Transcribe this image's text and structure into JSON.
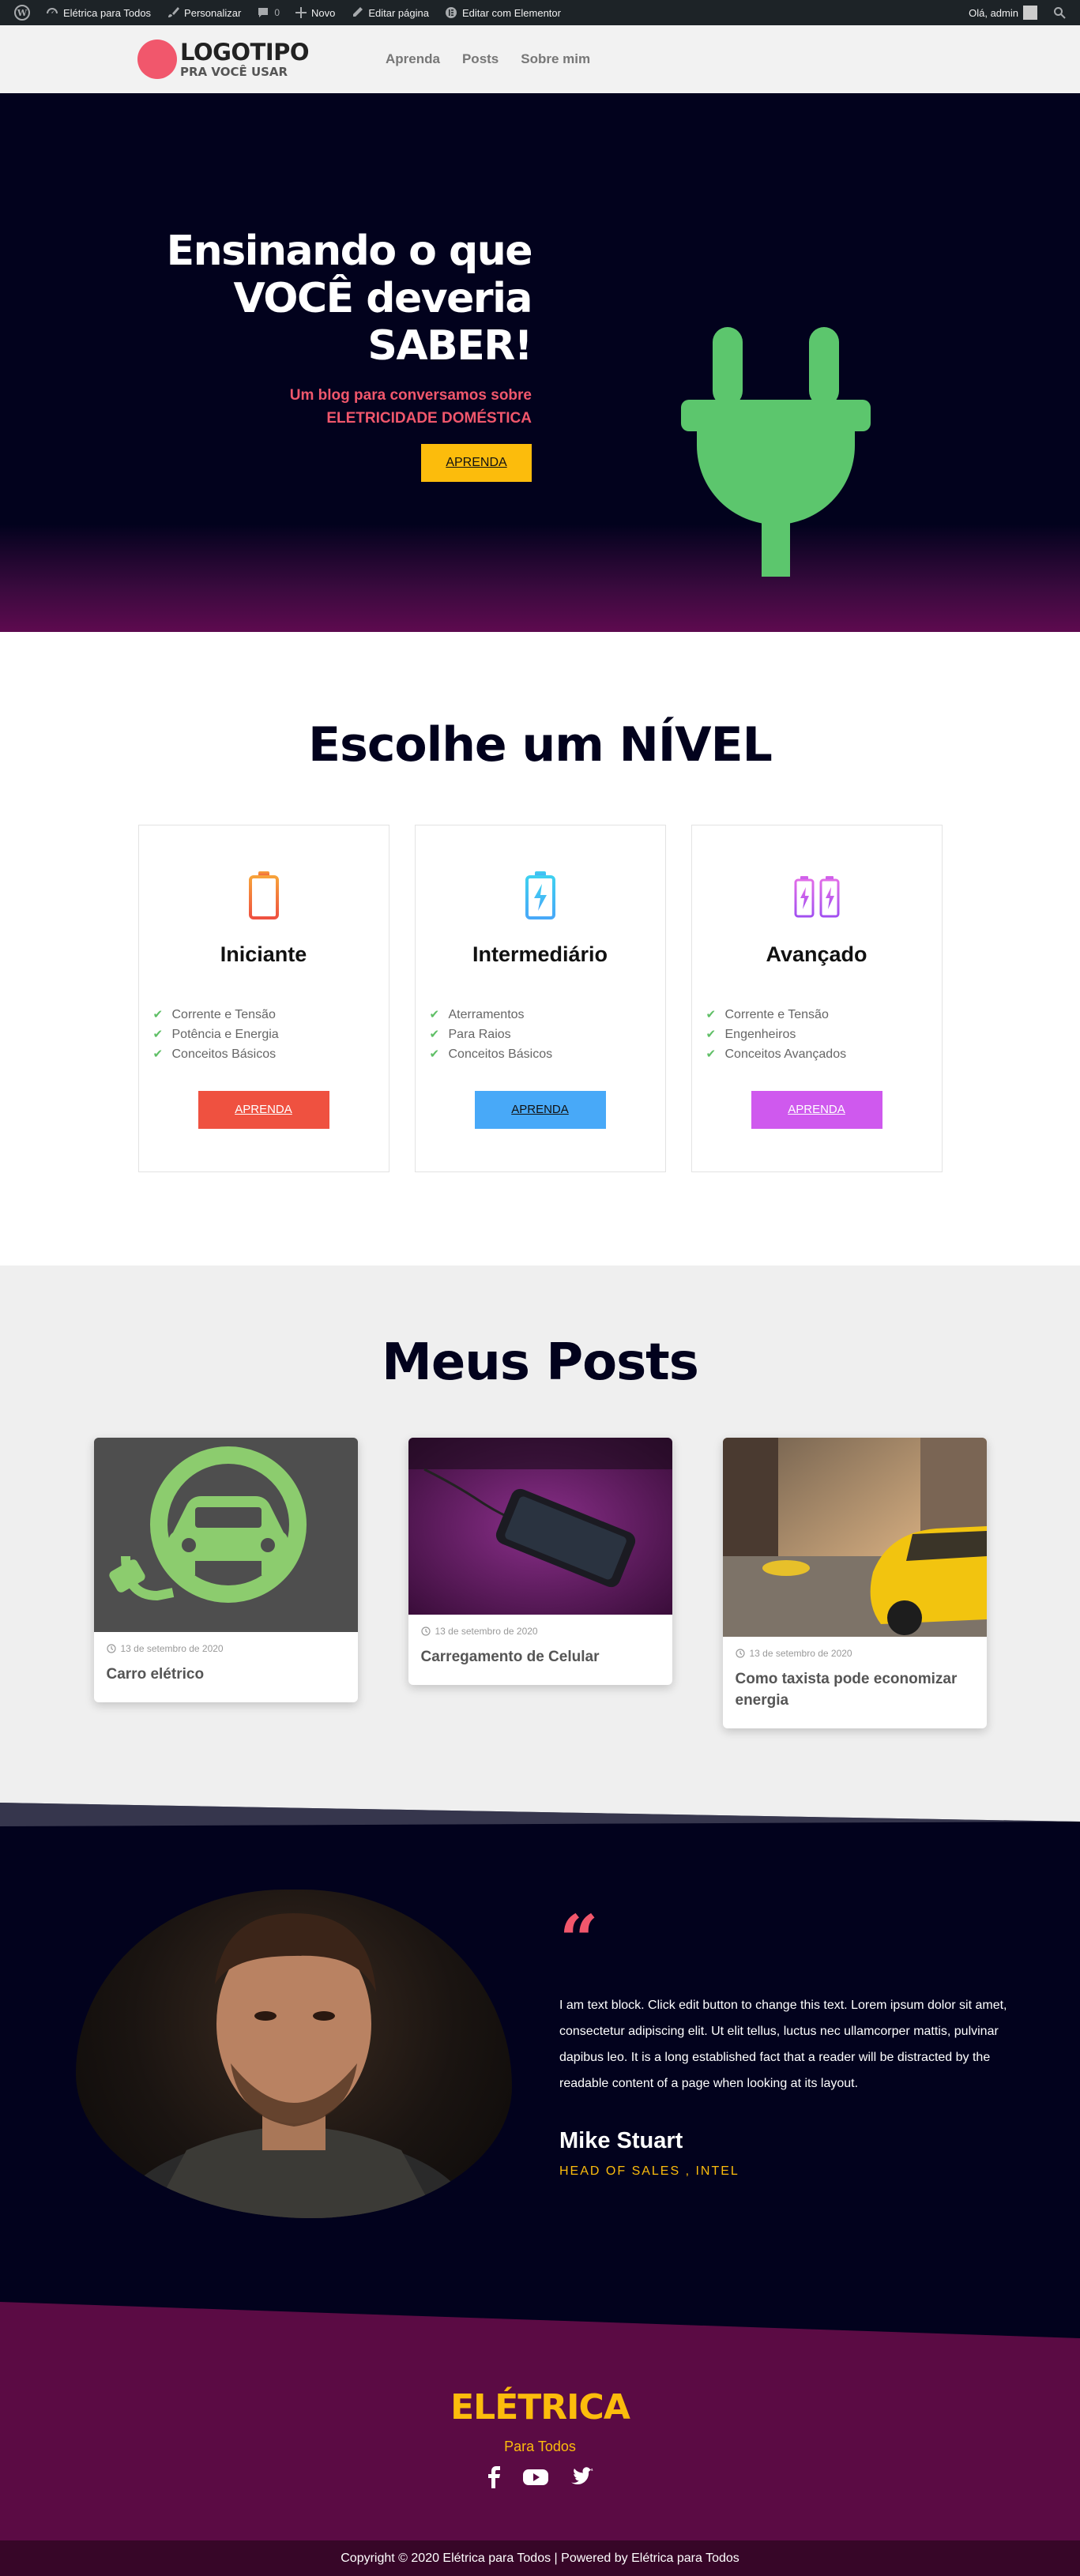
{
  "admin_bar": {
    "site_name": "Elétrica para Todos",
    "customize": "Personalizar",
    "comments_count": "0",
    "new": "Novo",
    "edit_page": "Editar página",
    "edit_elementor": "Editar com Elementor",
    "greeting": "Olá, admin"
  },
  "header": {
    "logo_title": "LOGOTIPO",
    "logo_subtitle": "PRA VOCÊ USAR",
    "nav": [
      "Aprenda",
      "Posts",
      "Sobre mim"
    ]
  },
  "hero": {
    "title_lines": [
      "Ensinando o que",
      "VOCÊ deveria",
      "SABER!"
    ],
    "subtitle_lines": [
      "Um blog para conversamos sobre",
      "ELETRICIDADE DOMÉSTICA"
    ],
    "button": "APRENDA",
    "icon": "plug-icon",
    "colors": {
      "background": "#02021d",
      "accent": "#f1576c",
      "plug": "#5cc66d",
      "button": "#fcbc0c"
    }
  },
  "levels": {
    "title": "Escolhe um NÍVEL",
    "cards": [
      {
        "title": "Iniciante",
        "icon": "battery-low-icon",
        "items": [
          "Corrente e Tensão",
          "Potência e Energia",
          "Conceitos Básicos"
        ],
        "button": "APRENDA",
        "color": "#ef5140"
      },
      {
        "title": "Intermediário",
        "icon": "battery-charging-icon",
        "items": [
          "Aterramentos",
          "Para Raios",
          "Conceitos Básicos"
        ],
        "button": "APRENDA",
        "color": "#48a9f8"
      },
      {
        "title": "Avançado",
        "icon": "batteries-icon",
        "items": [
          "Corrente e Tensão",
          "Engenheiros",
          "Conceitos Avançados"
        ],
        "button": "APRENDA",
        "color": "#cf59ee"
      }
    ]
  },
  "posts": {
    "title": "Meus Posts",
    "items": [
      {
        "date": "13 de setembro de 2020",
        "title": "Carro elétrico"
      },
      {
        "date": "13 de setembro de 2020",
        "title": "Carregamento de Celular"
      },
      {
        "date": "13 de setembro de 2020",
        "title": "Como taxista pode economizar energia"
      }
    ]
  },
  "testimonial": {
    "quote": "I am text block. Click edit button to change this text. Lorem ipsum dolor sit amet, consectetur adipiscing elit. Ut elit tellus, luctus nec ullamcorper mattis, pulvinar dapibus leo. It is a long established fact that a reader will be distracted by the readable content of a page when looking at its layout.",
    "name": "Mike Stuart",
    "role": "HEAD OF SALES , INTEL"
  },
  "footer": {
    "brand": "ELÉTRICA",
    "tagline": "Para Todos",
    "socials": [
      "facebook-icon",
      "youtube-icon",
      "twitter-icon"
    ],
    "copyright": "Copyright © 2020 Elétrica para Todos | Powered by Elétrica para Todos"
  }
}
